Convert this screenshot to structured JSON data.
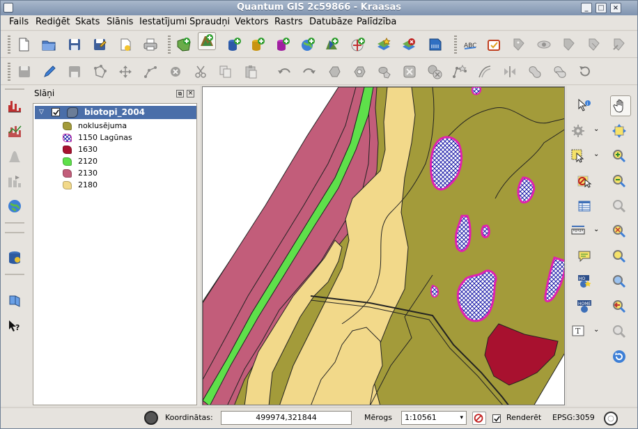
{
  "window": {
    "title": "Quantum GIS 2c59866 - Kraasas"
  },
  "menu": [
    "Fails",
    "Rediģēt",
    "Skats",
    "Slānis",
    "Iestatījumi",
    "Spraudņi",
    "Vektors",
    "Rastrs",
    "Datubāze",
    "Palīdzība"
  ],
  "toolbars": {
    "file_icons": [
      "new-project-icon",
      "open-project-icon",
      "save-project-icon",
      "save-as-icon",
      "new-print-composer-icon",
      "print-icon"
    ],
    "layer_icons": [
      "add-vector-layer-icon",
      "add-raster-layer-icon",
      "add-postgis-layer-icon",
      "add-spatialite-layer-icon",
      "add-mssql-layer-icon",
      "add-wms-layer-icon",
      "add-wcs-layer-icon",
      "add-wfs-layer-icon",
      "new-layer-icon",
      "remove-layer-icon",
      "add-delimited-text-icon"
    ],
    "misc_icons": [
      "spell-label-icon",
      "plugin-a-icon",
      "plugin-b-icon",
      "plugin-c-icon",
      "plugin-d-icon",
      "plugin-e-icon",
      "plugin-f-icon"
    ],
    "digitize_icons": [
      "save-edits-icon",
      "toggle-editing-icon",
      "current-edits-icon",
      "add-feature-icon",
      "move-feature-icon",
      "node-tool-icon",
      "delete-selected-icon",
      "cut-features-icon",
      "copy-features-icon",
      "paste-features-icon",
      "undo-icon",
      "redo-icon",
      "simplify-feature-icon",
      "add-ring-icon",
      "add-part-icon",
      "delete-ring-icon",
      "delete-part-icon",
      "reshape-icon",
      "offset-curve-icon",
      "split-features-icon",
      "merge-features-icon",
      "merge-attributes-icon",
      "rotate-symbol-icon"
    ]
  },
  "layers_panel": {
    "title": "Slāņi",
    "layer_name": "biotopi_2004",
    "legend": [
      {
        "label": "noklusējuma",
        "color": "#a39b3a",
        "pattern": ""
      },
      {
        "label": "1150 Lagūnas",
        "color": "#1a1aa8",
        "pattern": "cross"
      },
      {
        "label": "1630",
        "color": "#a8112f",
        "pattern": ""
      },
      {
        "label": "2120",
        "color": "#5ee04a",
        "pattern": ""
      },
      {
        "label": "2130",
        "color": "#c25d7a",
        "pattern": ""
      },
      {
        "label": "2180",
        "color": "#f2d98a",
        "pattern": ""
      }
    ]
  },
  "left_tools": [
    "histogram-a-icon",
    "histogram-b-icon",
    "histogram-c-icon",
    "histogram-d-icon",
    "globe-icon",
    "database-icon",
    "help-book-icon",
    "whats-this-icon"
  ],
  "right_tools": [
    "identify-icon",
    "pan-icon",
    "gear-icon",
    "pan-to-selection-icon",
    "select-icon",
    "zoom-in-icon",
    "deselect-icon",
    "zoom-out-icon",
    "attribute-table-icon",
    "zoom-full-icon",
    "measure-icon",
    "zoom-to-selection-icon",
    "map-tips-icon",
    "zoom-to-layer-icon",
    "new-bookmark-icon",
    "zoom-actual-icon",
    "show-bookmarks-icon",
    "zoom-last-icon",
    "text-annotation-icon",
    "zoom-next-icon",
    "refresh-icon"
  ],
  "status": {
    "coord_label": "Koordinātas:",
    "coord_value": "499974,321844",
    "scale_label": "Mērogs",
    "scale_value": "1:10561",
    "render_label": "Renderēt",
    "render_checked": true,
    "crs": "EPSG:3059"
  },
  "map_colors": {
    "default": "#a39b3a",
    "c1630": "#a8112f",
    "c2120": "#5ee04a",
    "c2130": "#c25d7a",
    "c2180": "#f2d98a",
    "lagoon_outline": "#e020b0"
  }
}
